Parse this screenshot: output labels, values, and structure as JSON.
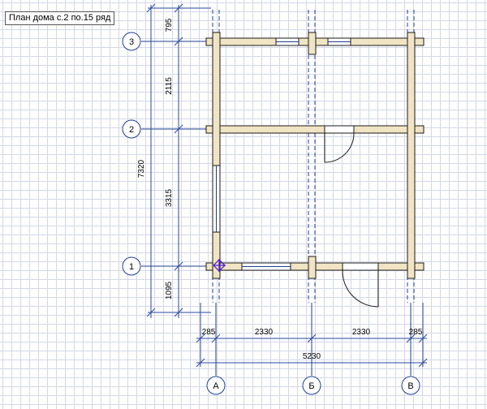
{
  "title": "План дома с.2 по.15 ряд",
  "axes": {
    "rows": [
      "3",
      "2",
      "1"
    ],
    "columns": [
      "А",
      "Б",
      "В"
    ]
  },
  "dimensions": {
    "vertical_segments": [
      "795",
      "2115",
      "3315",
      "1095"
    ],
    "vertical_total": "7320",
    "horizontal_segments": [
      "285",
      "2330",
      "2330",
      "285"
    ],
    "horizontal_total": "5230"
  },
  "colors": {
    "axis_lines": "#1f3f8f",
    "dimension_lines": "#2a4aa0",
    "walls_fill": "#f1e4c4",
    "walls_stroke": "#1a1a1a",
    "marker": "#5522cc",
    "grid": "#d4d8e6"
  }
}
